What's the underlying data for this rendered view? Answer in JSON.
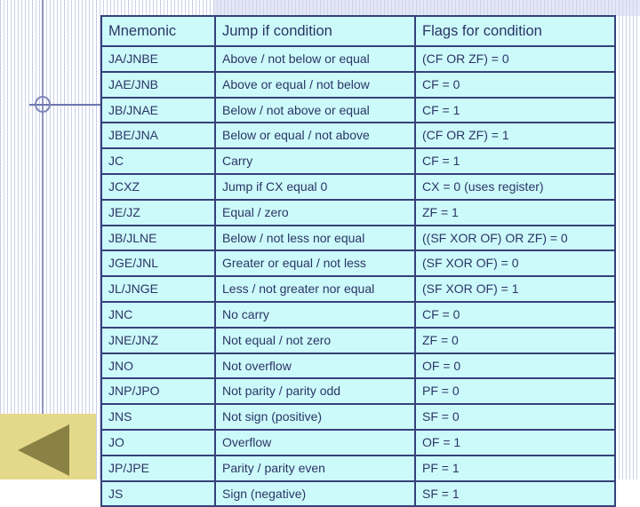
{
  "slide": {
    "title_hidden": "",
    "colors": {
      "table_fill": "#CCFAFA",
      "table_border": "#36417A",
      "text": "#2B3566",
      "deco_band": "#E4D98B",
      "deco_triangle": "#8A8144",
      "deco_line": "#8E96C4",
      "grid": "#828CC8"
    }
  },
  "table": {
    "headers": [
      "Mnemonic",
      "Jump if condition",
      "Flags for condition"
    ],
    "rows": [
      [
        "JA/JNBE",
        "Above / not below or equal",
        "(CF OR ZF) = 0"
      ],
      [
        "JAE/JNB",
        "Above or equal / not below",
        "CF = 0"
      ],
      [
        "JB/JNAE",
        "Below / not above or equal",
        "CF = 1"
      ],
      [
        "JBE/JNA",
        "Below or equal / not above",
        "(CF OR ZF) = 1"
      ],
      [
        "JC",
        "Carry",
        "CF = 1"
      ],
      [
        "JCXZ",
        "Jump if CX equal 0",
        "CX = 0 (uses register)"
      ],
      [
        "JE/JZ",
        "Equal / zero",
        "ZF = 1"
      ],
      [
        "JB/JLNE",
        "Below / not less nor equal",
        "((SF XOR OF) OR ZF) = 0"
      ],
      [
        "JGE/JNL",
        "Greater or equal / not less",
        "(SF XOR OF) = 0"
      ],
      [
        "JL/JNGE",
        "Less / not greater nor equal",
        "(SF XOR OF) = 1"
      ],
      [
        "JNC",
        "No carry",
        "CF = 0"
      ],
      [
        "JNE/JNZ",
        "Not equal / not zero",
        "ZF = 0"
      ],
      [
        "JNO",
        "Not overflow",
        "OF = 0"
      ],
      [
        "JNP/JPO",
        "Not parity / parity odd",
        "PF = 0"
      ],
      [
        "JNS",
        "Not sign (positive)",
        "SF = 0"
      ],
      [
        "JO",
        "Overflow",
        "OF = 1"
      ],
      [
        "JP/JPE",
        "Parity / parity even",
        "PF = 1"
      ],
      [
        "JS",
        "Sign (negative)",
        "SF = 1"
      ]
    ]
  }
}
